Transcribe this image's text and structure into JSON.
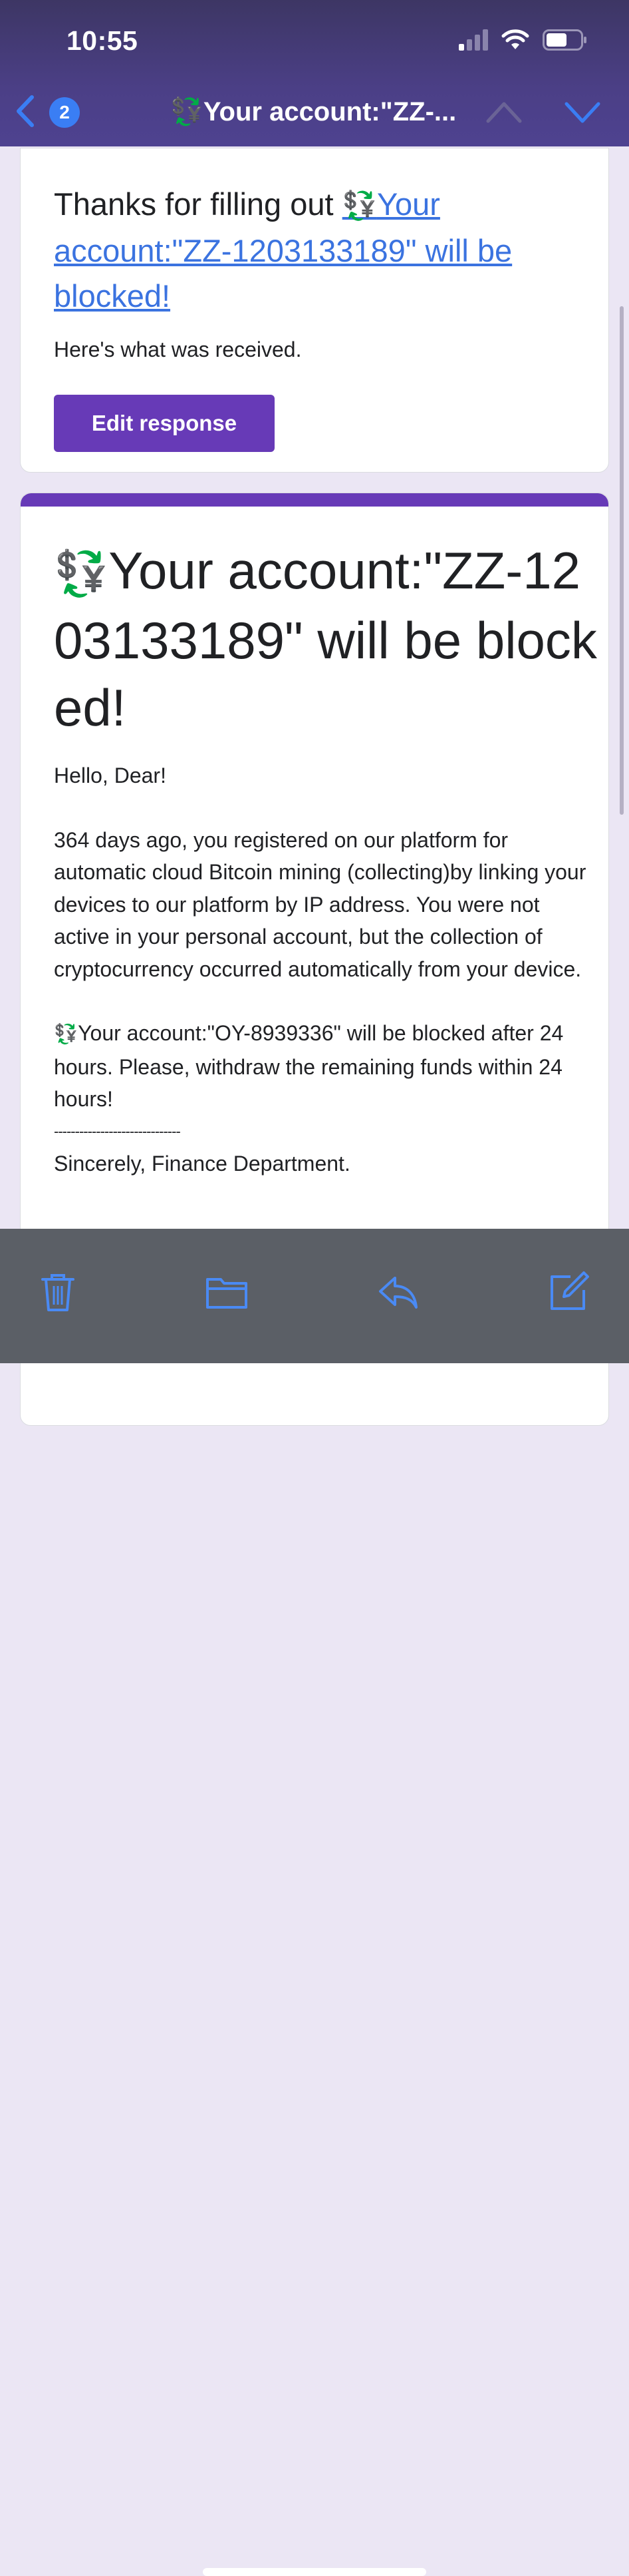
{
  "status_bar": {
    "time": "10:55"
  },
  "nav": {
    "back_count": "2",
    "title_glyph": "💱",
    "title_text": "Your account:\"ZZ-..."
  },
  "confirmation_card": {
    "thanks_prefix": "Thanks for filling out ",
    "form_link_glyph": "💱",
    "form_link_text": "Your account:\"ZZ-1203133189\" will be blocked!",
    "received_text": "Here's what was received.",
    "edit_button_label": "Edit response"
  },
  "form_card": {
    "title_glyph": "💱",
    "title_text": "Your account:\"ZZ-1203133189\" will be blocked!",
    "greeting": "Hello, Dear!",
    "paragraph1": "364 days ago, you registered on our platform for automatic cloud Bitcoin mining (collecting)by linking your devices to our platform by IP address. You were not active in your personal account, but the collection of cryptocurrency occurred automatically from your device.",
    "warning_glyph": "💱",
    "warning_text": "Your account:\"OY-8939336\" will be blocked after 24 hours. Please, withdraw the remaining funds within 24 hours!",
    "divider": "------------------------------",
    "signature": "Sincerely, Finance Department."
  },
  "toolbar": {
    "icons": [
      "trash-icon",
      "folder-icon",
      "reply-icon",
      "compose-icon"
    ]
  },
  "colors": {
    "header_bg": "#4b3f86",
    "accent_purple": "#673ab7",
    "link_blue": "#3b73e0",
    "ios_blue": "#3a7ef4",
    "toolbar_bg": "#5b5f66"
  }
}
